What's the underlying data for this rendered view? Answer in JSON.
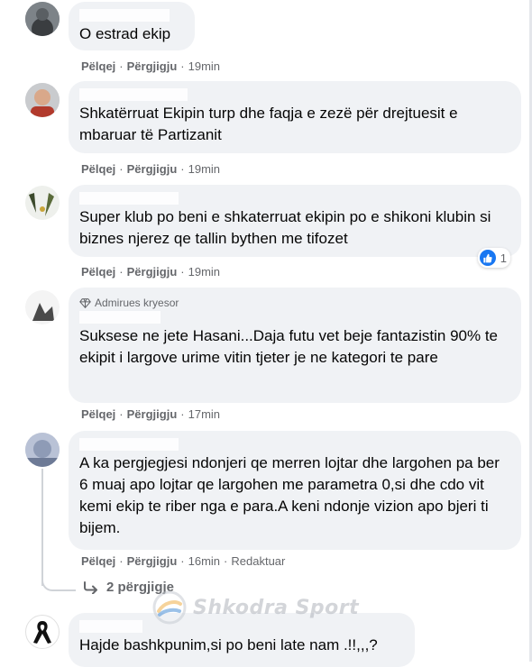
{
  "comments": [
    {
      "text": "O estrad ekip",
      "actions": {
        "like": "Pëlqej",
        "reply": "Përgjigju",
        "time": "19min",
        "edited": ""
      }
    },
    {
      "text": "Shkatërruat Ekipin turp dhe faqja e zezë për drejtuesit e mbaruar të Partizanit",
      "actions": {
        "like": "Pëlqej",
        "reply": "Përgjigju",
        "time": "19min",
        "edited": ""
      }
    },
    {
      "text": "Super klub po beni e shkaterruat ekipin po e shikoni klubin si biznes njerez qe tallin bythen me tifozet",
      "actions": {
        "like": "Pëlqej",
        "reply": "Përgjigju",
        "time": "19min",
        "edited": ""
      },
      "reaction_count": "1"
    },
    {
      "badge": "Admirues kryesor",
      "text": "Suksese ne jete Hasani...Daja futu vet beje fantazistin 90% te ekipit i largove urime vitin tjeter je ne kategori te pare",
      "actions": {
        "like": "Pëlqej",
        "reply": "Përgjigju",
        "time": "17min",
        "edited": ""
      }
    },
    {
      "text": "A ka pergjegjesi ndonjeri qe merren lojtar dhe largohen pa ber 6 muaj apo lojtar qe largohen me parametra 0,si dhe cdo vit kemi ekip te riber nga e para.A keni ndonje vizion apo bjeri ti bijem.",
      "actions": {
        "like": "Pëlqej",
        "reply": "Përgjigju",
        "time": "16min",
        "edited": "Redaktuar"
      },
      "replies": "2 përgjigje"
    },
    {
      "text": "Hajde bashkpunim,si po beni late nam .!!,,,?"
    }
  ],
  "watermark": "Shkodra Sport",
  "colors": {
    "bubble": "#f0f2f5",
    "meta": "#65676b",
    "like": "#1877f2"
  }
}
